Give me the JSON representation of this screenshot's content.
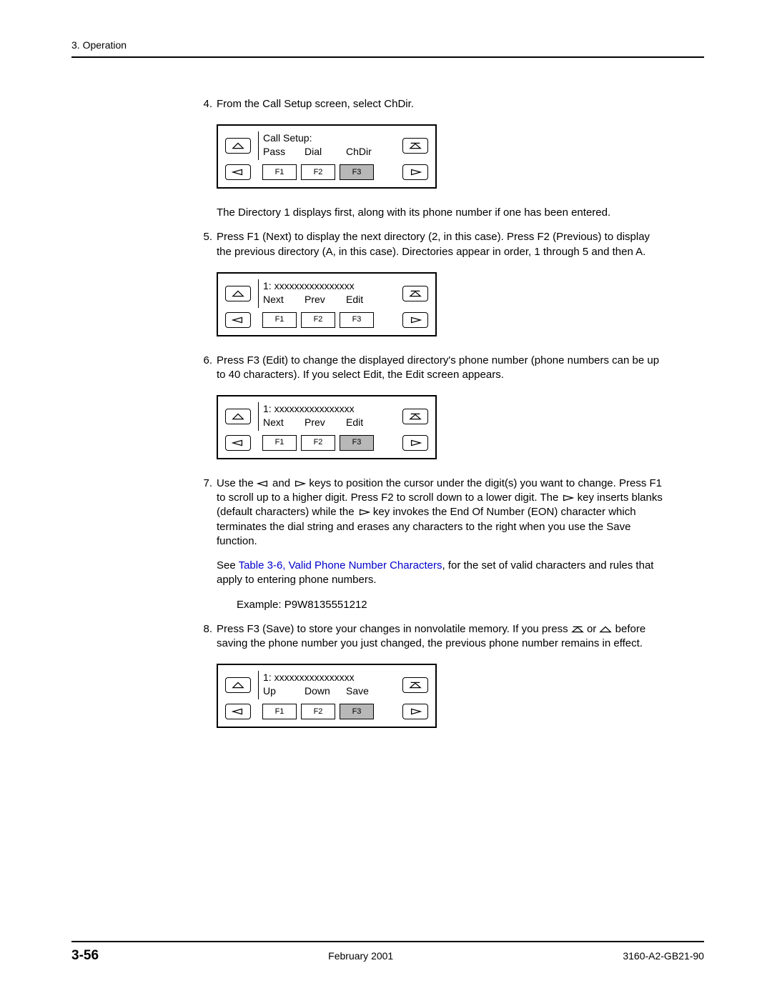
{
  "header": "3. Operation",
  "steps": {
    "s4": {
      "num": "4.",
      "text": "From the Call Setup screen, select ChDir."
    },
    "s4_after": "The Directory 1 displays first, along with its phone number if one has been entered.",
    "s5": {
      "num": "5.",
      "text": "Press F1 (Next) to display the next directory (2, in this case). Press F2 (Previous) to display the previous directory (A, in this case). Directories appear in order, 1 through 5 and then A."
    },
    "s6": {
      "num": "6.",
      "text": "Press F3 (Edit) to change the displayed directory's phone number (phone numbers can be up to 40 characters). If you select Edit, the Edit screen appears."
    },
    "s7": {
      "num": "7.",
      "pre": "Use the ",
      "mid1": " and ",
      "mid2": " keys to position the cursor under the digit(s) you want to change. Press F1 to scroll up to a higher digit. Press F2 to scroll down to a lower digit. The ",
      "mid3": " key inserts blanks (default characters) while the ",
      "post": " key invokes the End Of Number (EON) character which terminates the dial string and erases any characters to the right when you use the Save function."
    },
    "s7_see_pre": "See ",
    "s7_link": "Table 3-6, Valid Phone Number Characters",
    "s7_see_post": ", for the set of valid characters and rules that apply to entering phone numbers.",
    "s7_example": "Example: P9W8135551212",
    "s8": {
      "num": "8.",
      "pre": "Press F3 (Save) to store your changes in nonvolatile memory. If you press ",
      "mid": " or ",
      "post": " before saving the phone number you just changed, the previous phone number remains in effect."
    }
  },
  "panels": {
    "p1": {
      "line1": "Call Setup:",
      "opts": [
        "Pass",
        "Dial",
        "ChDir"
      ],
      "fkeys": [
        "F1",
        "F2",
        "F3"
      ],
      "hl": 2
    },
    "p2": {
      "line1": "1: xxxxxxxxxxxxxxxx",
      "opts": [
        "Next",
        "Prev",
        "Edit"
      ],
      "fkeys": [
        "F1",
        "F2",
        "F3"
      ],
      "hl": -1
    },
    "p3": {
      "line1": "1: xxxxxxxxxxxxxxxx",
      "opts": [
        "Next",
        "Prev",
        "Edit"
      ],
      "fkeys": [
        "F1",
        "F2",
        "F3"
      ],
      "hl": 2
    },
    "p4": {
      "line1": "1: xxxxxxxxxxxxxxxx",
      "opts": [
        "Up",
        "Down",
        "Save"
      ],
      "fkeys": [
        "F1",
        "F2",
        "F3"
      ],
      "hl": 2
    }
  },
  "footer": {
    "page": "3-56",
    "date": "February 2001",
    "doc": "3160-A2-GB21-90"
  }
}
